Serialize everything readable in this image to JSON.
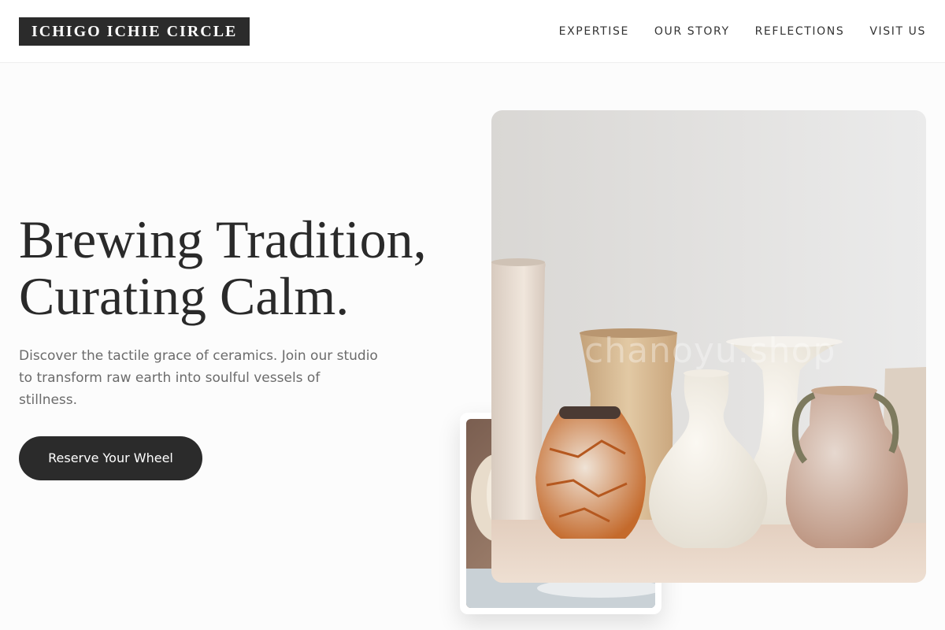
{
  "brand": {
    "name": "ICHIGO ICHIE CIRCLE"
  },
  "nav": {
    "items": [
      "EXPERTISE",
      "OUR STORY",
      "REFLECTIONS",
      "VISIT US"
    ]
  },
  "hero": {
    "title_line1": "Brewing Tradition,",
    "title_line2": "Curating Calm.",
    "description": "Discover the tactile grace of ceramics. Join our studio to transform raw earth into soulful vessels of stillness.",
    "cta_label": "Reserve Your Wheel"
  },
  "images": {
    "main_watermark": "chanoyu.shop"
  },
  "colors": {
    "background": "#fcfcfc",
    "text_dark": "#2b2b2b",
    "text_muted": "#6b6b6b",
    "button": "#2b2b2b"
  }
}
